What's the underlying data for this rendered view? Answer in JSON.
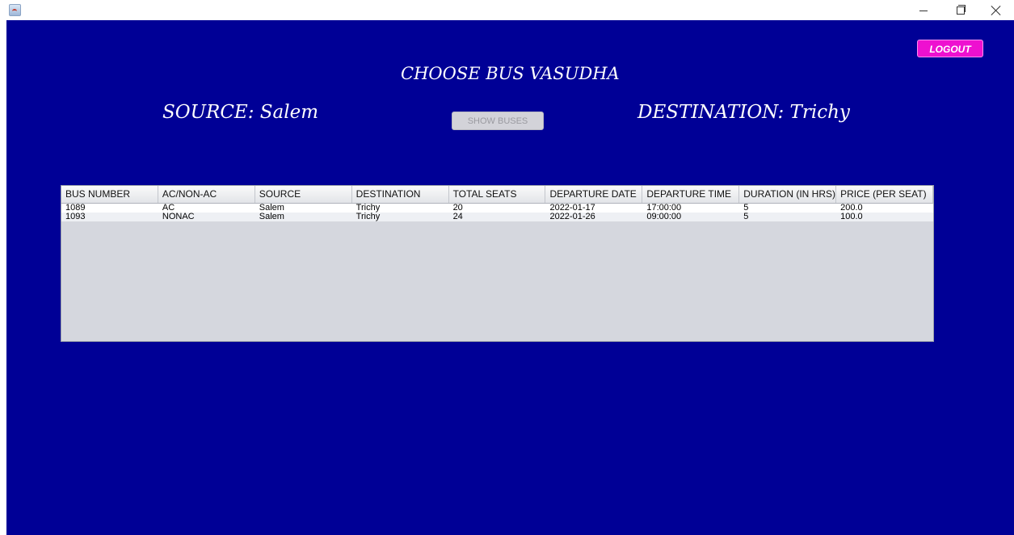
{
  "window": {
    "minimize_label": "–",
    "maximize_label": "",
    "close_label": ""
  },
  "header": {
    "title": "CHOOSE BUS VASUDHA",
    "source": "SOURCE: Salem",
    "destination": "DESTINATION: Trichy",
    "show_buses_label": "SHOW BUSES",
    "logout_label": "LOGOUT"
  },
  "colors": {
    "background": "#000096",
    "logout": "#ee10d0"
  },
  "table": {
    "columns": [
      "BUS NUMBER",
      "AC/NON-AC",
      "SOURCE",
      "DESTINATION",
      "TOTAL SEATS",
      "DEPARTURE DATE",
      "DEPARTURE TIME",
      "DURATION (IN HRS)",
      "PRICE (PER SEAT)"
    ],
    "rows": [
      [
        "1089",
        "AC",
        "Salem",
        "Trichy",
        "20",
        "2022-01-17",
        "17:00:00",
        "5",
        "200.0"
      ],
      [
        "1093",
        "NONAC",
        "Salem",
        "Trichy",
        "24",
        "2022-01-26",
        "09:00:00",
        "5",
        "100.0"
      ]
    ]
  }
}
